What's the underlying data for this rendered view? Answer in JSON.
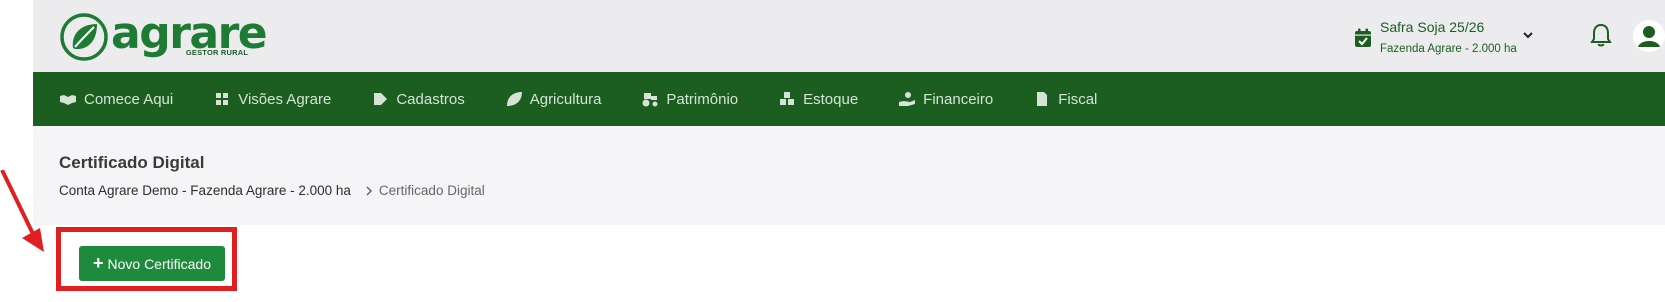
{
  "brand": {
    "name": "agrare",
    "tagline": "GESTOR RURAL",
    "color": "#1e7b34"
  },
  "header": {
    "safra_title": "Safra Soja 25/26",
    "safra_sub": "Fazenda Agrare - 2.000 ha",
    "icons": [
      "calendar-check-icon",
      "chevron-down-icon",
      "bell-icon",
      "user-avatar-icon"
    ]
  },
  "nav": {
    "items": [
      {
        "label": "Comece Aqui",
        "icon": "handshake-icon"
      },
      {
        "label": "Visões Agrare",
        "icon": "dashboard-icon"
      },
      {
        "label": "Cadastros",
        "icon": "tag-icon"
      },
      {
        "label": "Agricultura",
        "icon": "leaf-icon"
      },
      {
        "label": "Patrimônio",
        "icon": "tractor-icon"
      },
      {
        "label": "Estoque",
        "icon": "boxes-icon"
      },
      {
        "label": "Financeiro",
        "icon": "hand-coin-icon"
      },
      {
        "label": "Fiscal",
        "icon": "invoice-icon"
      }
    ]
  },
  "page": {
    "title": "Certificado Digital",
    "breadcrumb": [
      "Conta Agrare Demo - Fazenda Agrare - 2.000 ha",
      "Certificado Digital"
    ]
  },
  "actions": {
    "new_button": "Novo Certificado"
  },
  "colors": {
    "nav_bg": "#1b5e20",
    "button_bg": "#1e8a3c",
    "highlight": "#e02020"
  }
}
